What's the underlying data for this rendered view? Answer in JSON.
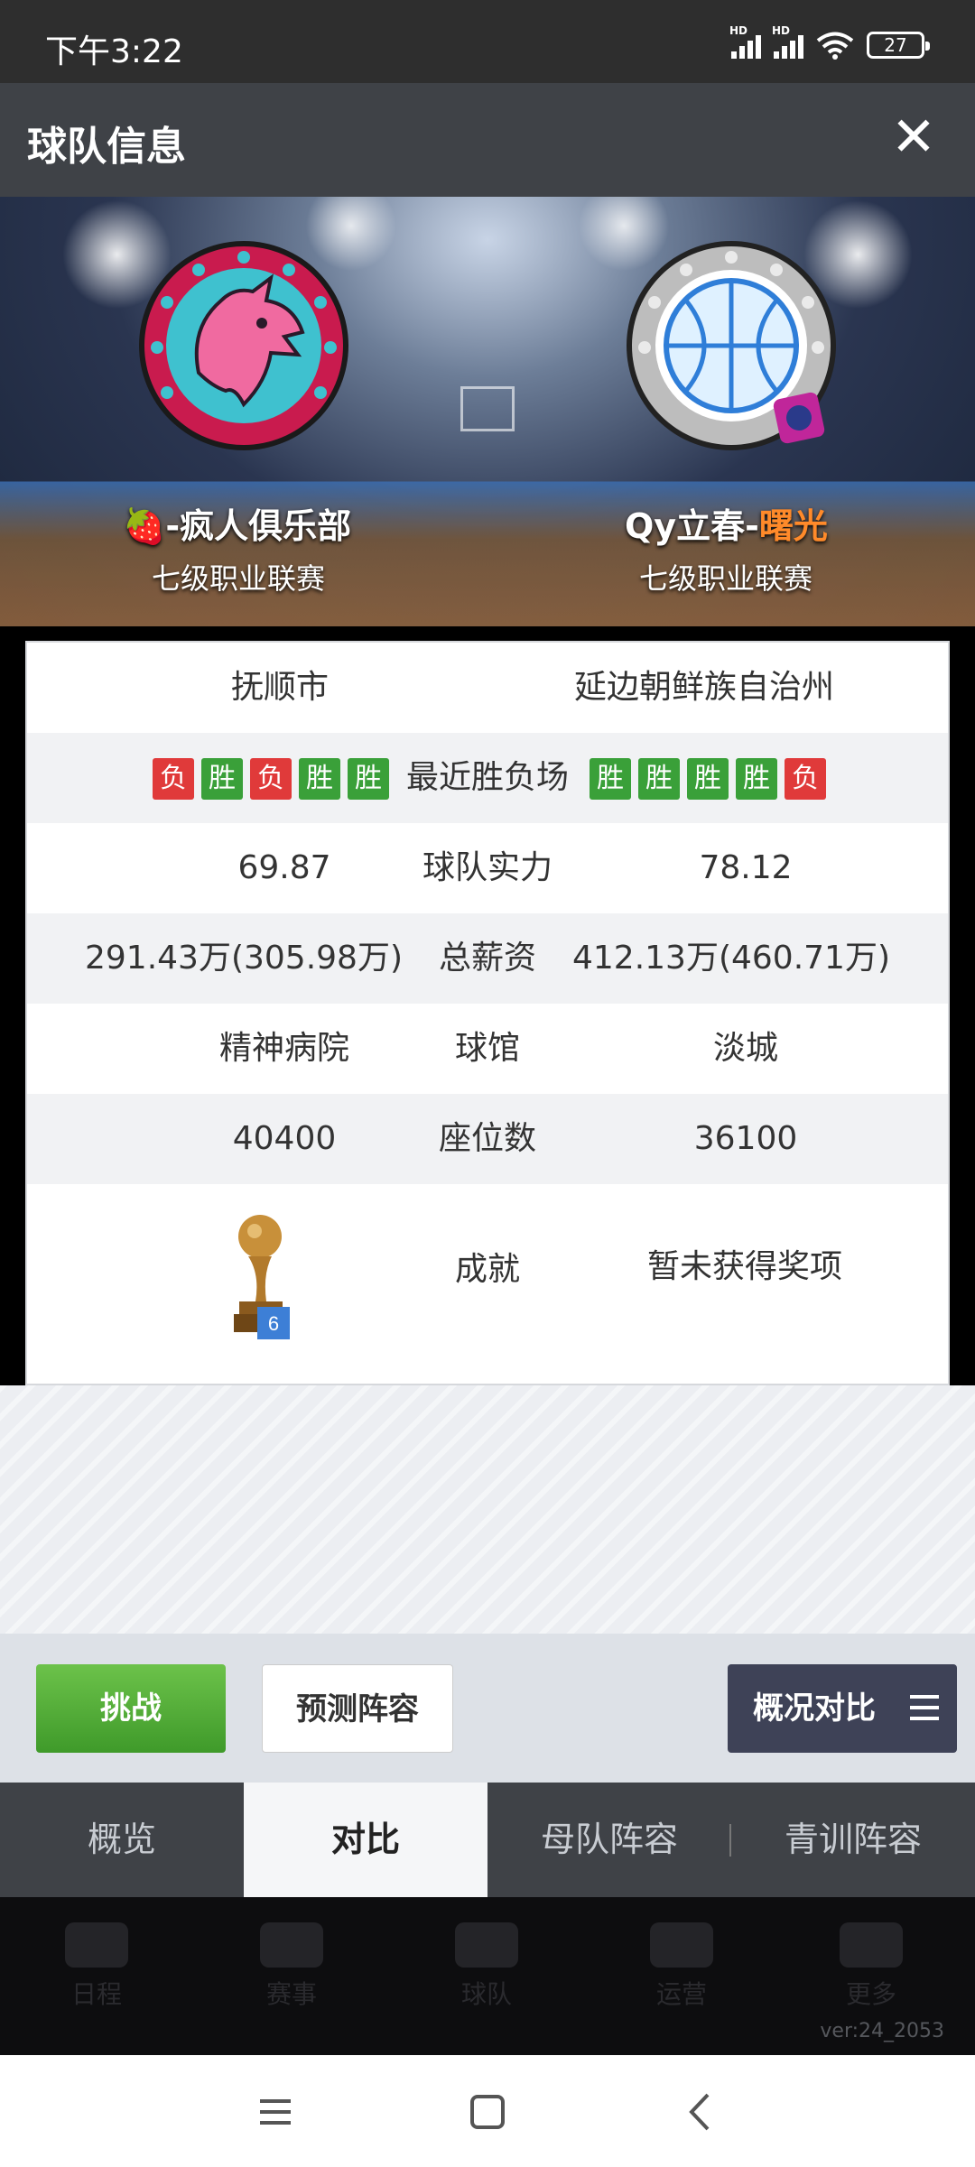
{
  "status_bar": {
    "time": "下午3:22",
    "signal_tag": "HD",
    "battery": "27"
  },
  "header": {
    "title": "球队信息",
    "close": "✕"
  },
  "teams": {
    "left": {
      "name_prefix": "🍓",
      "name": "-疯人俱乐部",
      "league": "七级职业联赛",
      "city": "抚顺市"
    },
    "right": {
      "name_main": "Qy立春-",
      "name_accent": "曙光",
      "league": "七级职业联赛",
      "city": "延边朝鲜族自治州"
    }
  },
  "comparison": {
    "recent_label": "最近胜负场",
    "left_recent": [
      "负",
      "胜",
      "负",
      "胜",
      "胜"
    ],
    "right_recent": [
      "胜",
      "胜",
      "胜",
      "胜",
      "负"
    ],
    "strength": {
      "label": "球队实力",
      "left": "69.87",
      "right": "78.12"
    },
    "salary": {
      "label": "总薪资",
      "left": "291.43万(305.98万)",
      "right": "412.13万(460.71万)"
    },
    "arena": {
      "label": "球馆",
      "left": "精神病院",
      "right": "淡城"
    },
    "seats": {
      "label": "座位数",
      "left": "40400",
      "right": "36100"
    },
    "achievements": {
      "label": "成就",
      "left_trophy_count": "6",
      "right": "暂未获得奖项"
    }
  },
  "actions": {
    "challenge": "挑战",
    "predict": "预测阵容",
    "compare": "概况对比"
  },
  "tabs": [
    "概览",
    "对比",
    "母队阵容",
    "青训阵容"
  ],
  "active_tab": "对比",
  "dock": [
    "日程",
    "赛事",
    "球队",
    "运营",
    "更多"
  ],
  "version": "ver:24_2053",
  "colors": {
    "win": "#3aa039",
    "lose": "#e03a3a",
    "accent": "#ff8a2a",
    "header": "#3f4247"
  }
}
